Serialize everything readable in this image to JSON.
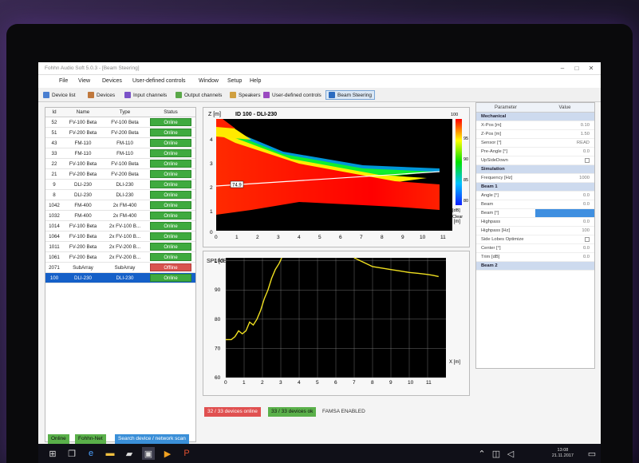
{
  "window": {
    "title": "Fohhn Audio Soft 5.0.3 - [Beam Steering]"
  },
  "menu": [
    "File",
    "View",
    "Devices",
    "User-defined controls",
    "Window",
    "Setup",
    "Help"
  ],
  "toolbar": [
    {
      "label": "Device list",
      "color": "#4a7fd0"
    },
    {
      "label": "Devices",
      "color": "#c0783c"
    },
    {
      "label": "Input channels",
      "color": "#7a52c8"
    },
    {
      "label": "Output channels",
      "color": "#5aa848"
    },
    {
      "label": "Speakers",
      "color": "#d0a040"
    },
    {
      "label": "User-defined controls",
      "color": "#9a4ac0"
    },
    {
      "label": "Beam Steering",
      "color": "#2c6cc0",
      "active": true
    }
  ],
  "device_table": {
    "headers": [
      "Id",
      "Name",
      "Type",
      "Status"
    ],
    "rows": [
      {
        "id": "52",
        "name": "FV-100 Beta",
        "type": "FV-100 Beta",
        "status": "Online"
      },
      {
        "id": "51",
        "name": "FV-200 Beta",
        "type": "FV-200 Beta",
        "status": "Online"
      },
      {
        "id": "43",
        "name": "FM-110",
        "type": "FM-110",
        "status": "Online"
      },
      {
        "id": "33",
        "name": "FM-110",
        "type": "FM-110",
        "status": "Online"
      },
      {
        "id": "22",
        "name": "FV-100 Beta",
        "type": "FV-100 Beta",
        "status": "Online"
      },
      {
        "id": "21",
        "name": "FV-200 Beta",
        "type": "FV-200 Beta",
        "status": "Online"
      },
      {
        "id": "9",
        "name": "DLI-230",
        "type": "DLI-230",
        "status": "Online"
      },
      {
        "id": "8",
        "name": "DLI-230",
        "type": "DLI-230",
        "status": "Online"
      },
      {
        "id": "1042",
        "name": "FM-400",
        "type": "2x FM-400",
        "status": "Online"
      },
      {
        "id": "1032",
        "name": "FM-400",
        "type": "2x FM-400",
        "status": "Online"
      },
      {
        "id": "1014",
        "name": "FV-100 Beta",
        "type": "2x FV-100 B...",
        "status": "Online"
      },
      {
        "id": "1064",
        "name": "FV-100 Beta",
        "type": "2x FV-100 B...",
        "status": "Online"
      },
      {
        "id": "1011",
        "name": "FV-200 Beta",
        "type": "2x FV-200 B...",
        "status": "Online"
      },
      {
        "id": "1061",
        "name": "FV-200 Beta",
        "type": "2x FV-200 B...",
        "status": "Online"
      },
      {
        "id": "2071",
        "name": "SubArray",
        "type": "SubArray",
        "status": "Offline"
      },
      {
        "id": "100",
        "name": "DLI-230",
        "type": "DLI-230",
        "status": "Online",
        "selected": true
      }
    ]
  },
  "beam_plot": {
    "title": "ID 100 - DLI-230",
    "ylabel": "Z [m]",
    "xlabel": "X [m]",
    "y_ticks": [
      "4",
      "3",
      "2",
      "1",
      "0"
    ],
    "x_ticks": [
      "0",
      "1",
      "2",
      "3",
      "4",
      "5",
      "6",
      "7",
      "8",
      "9",
      "10",
      "11"
    ],
    "marker_value": "74.9",
    "colorbar_ticks": [
      "100",
      "95",
      "90",
      "85",
      "80"
    ],
    "colorbar_unit": "[dB]",
    "clear_label": "Clear"
  },
  "chart_data": {
    "type": "line",
    "title": "",
    "ylabel": "SPL [dB]",
    "xlabel": "X [m]",
    "xlim": [
      0,
      12
    ],
    "ylim": [
      60,
      101
    ],
    "x_ticks": [
      0,
      1,
      2,
      3,
      4,
      5,
      6,
      7,
      8,
      9,
      10,
      11
    ],
    "y_ticks": [
      60,
      70,
      80,
      90,
      100
    ],
    "grid": true,
    "series": [
      {
        "color": "#f0e020",
        "x": [
          0,
          0.3,
          0.5,
          0.7,
          0.9,
          1.1,
          1.3,
          1.5,
          1.7,
          1.9,
          2.1,
          2.3,
          2.5,
          2.7,
          2.9,
          3.05,
          7.0,
          7.5,
          8.0,
          8.5,
          9.0,
          9.5,
          10.0,
          10.5,
          11.0,
          11.3,
          11.6
        ],
        "y": [
          73,
          73,
          74,
          76,
          75,
          76,
          79,
          78,
          80,
          83,
          87,
          90,
          94,
          97,
          99,
          101,
          101,
          99.5,
          98,
          97.5,
          97,
          96.5,
          96,
          95.7,
          95.3,
          95,
          94.6
        ]
      }
    ]
  },
  "parameters": {
    "headers": [
      "Parameter",
      "Value"
    ],
    "rows": [
      {
        "label": "Mechanical",
        "section": true
      },
      {
        "label": "X-Pos [m]",
        "value": "0.10"
      },
      {
        "label": "Z-Pos [m]",
        "value": "1.50"
      },
      {
        "label": "Sensor [°]",
        "value": "READ"
      },
      {
        "label": "Pre-Angle [°]",
        "value": "0.0"
      },
      {
        "label": "UpSideDown",
        "check": true
      },
      {
        "label": "Simulation",
        "section": true
      },
      {
        "label": "Frequency [Hz]",
        "value": "1000"
      },
      {
        "label": "Beam 1",
        "section": true
      },
      {
        "label": "Angle [°]",
        "value": "0.0"
      },
      {
        "label": "Beam",
        "value": "0.0"
      },
      {
        "label": "Beam [°]",
        "value": "",
        "selected": true
      },
      {
        "label": "Highpass",
        "value": "0.0"
      },
      {
        "label": "Highpass [Hz]",
        "value": "100"
      },
      {
        "label": "Side Lobes Optimize",
        "check": true
      },
      {
        "label": "Center [°]",
        "value": "0.0"
      },
      {
        "label": "Trim [dB]",
        "value": "0.0"
      },
      {
        "label": "Beam 2",
        "section": true
      }
    ]
  },
  "status_bar": {
    "devices_online": "32 / 33 devices online",
    "devices_ok": "33 / 33 devices ok",
    "famsa": "FAMSA ENABLED"
  },
  "bottom_bar": {
    "online": "Online",
    "net": "Fohhn-Net",
    "search": "Search device / network scan"
  },
  "taskbar": {
    "time": "13:08",
    "date": "21.11.2017"
  },
  "colors": {
    "online": "#3faa3f",
    "offline": "#d9534f",
    "selected_row": "#1560c8",
    "plot_bg": "#000000",
    "spl_line": "#f0e020"
  }
}
